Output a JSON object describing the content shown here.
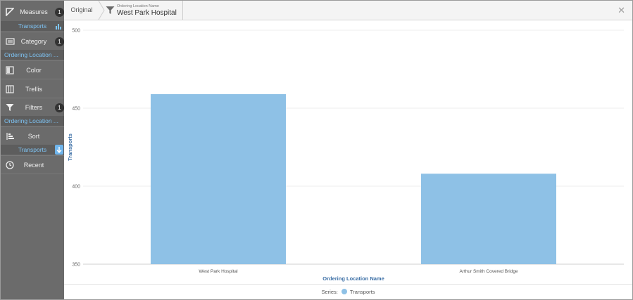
{
  "sidebar": {
    "measures": {
      "label": "Measures",
      "badge": "1",
      "sub": "Transports"
    },
    "category": {
      "label": "Category",
      "badge": "1",
      "sub": "Ordering Location ..."
    },
    "color": {
      "label": "Color"
    },
    "trellis": {
      "label": "Trellis"
    },
    "filters": {
      "label": "Filters",
      "badge": "1",
      "sub": "Ordering Location ..."
    },
    "sort": {
      "label": "Sort",
      "sub": "Transports"
    },
    "recent": {
      "label": "Recent"
    }
  },
  "header": {
    "original_label": "Original",
    "filter_field": "Ordering Location Name",
    "filter_value": "West Park Hospital",
    "close_label": "✕"
  },
  "legend": {
    "prefix": "Series:",
    "series_name": "Transports"
  },
  "colors": {
    "bar": "#8ec1e6",
    "accent": "#6fb5ec",
    "sidebar": "#6b6b6b"
  },
  "chart_data": {
    "type": "bar",
    "categories": [
      "West Park Hospital",
      "Arthur Smith Covered Bridge"
    ],
    "series": [
      {
        "name": "Transports",
        "values": [
          459,
          408
        ]
      }
    ],
    "xlabel": "Ordering Location Name",
    "ylabel": "Transports",
    "ylim": [
      350,
      500
    ],
    "yticks": [
      350,
      400,
      450,
      500
    ],
    "grid": true,
    "legend_placement": "bottom"
  }
}
